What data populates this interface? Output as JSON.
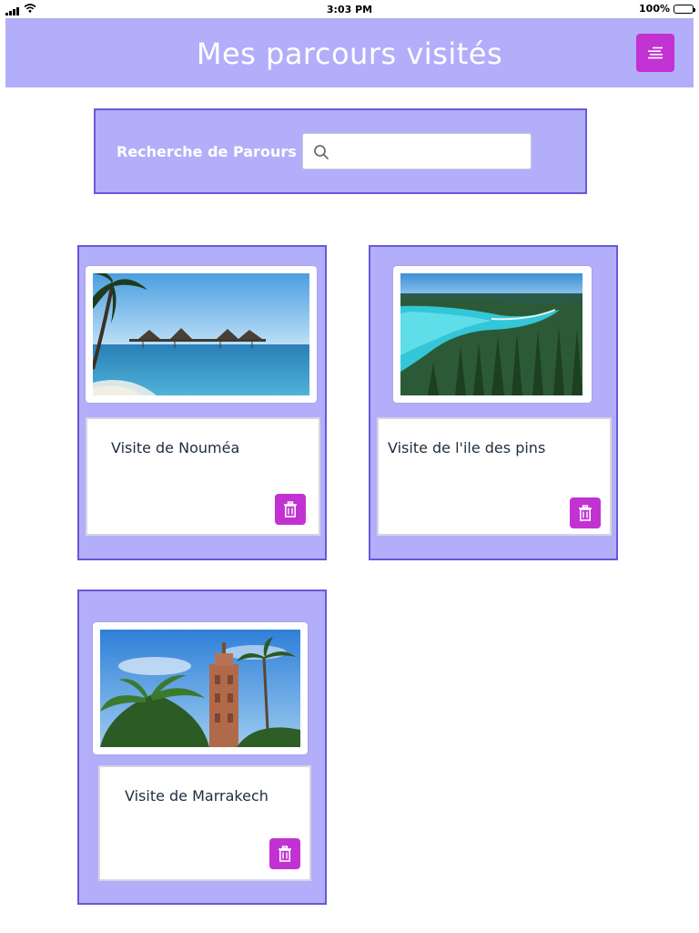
{
  "status_bar": {
    "time": "3:03 PM",
    "battery": "100%"
  },
  "header": {
    "title": "Mes parcours visités",
    "menu_icon": "menu-lines-icon"
  },
  "search": {
    "label": "Recherche de Parours",
    "placeholder": "",
    "value": "",
    "icon": "search-icon"
  },
  "cards": [
    {
      "title": "Visite de Nouméa",
      "image": "noumea-beach-photo",
      "delete_icon": "trash-icon"
    },
    {
      "title": "Visite de l'ile des pins",
      "image": "ile-des-pins-lagoon-photo",
      "delete_icon": "trash-icon"
    },
    {
      "title": "Visite de Marrakech",
      "image": "marrakech-minaret-photo",
      "delete_icon": "trash-icon"
    }
  ],
  "colors": {
    "header_bg": "#b3aef9",
    "card_border": "#6659d7",
    "accent_button": "#c232d2"
  }
}
